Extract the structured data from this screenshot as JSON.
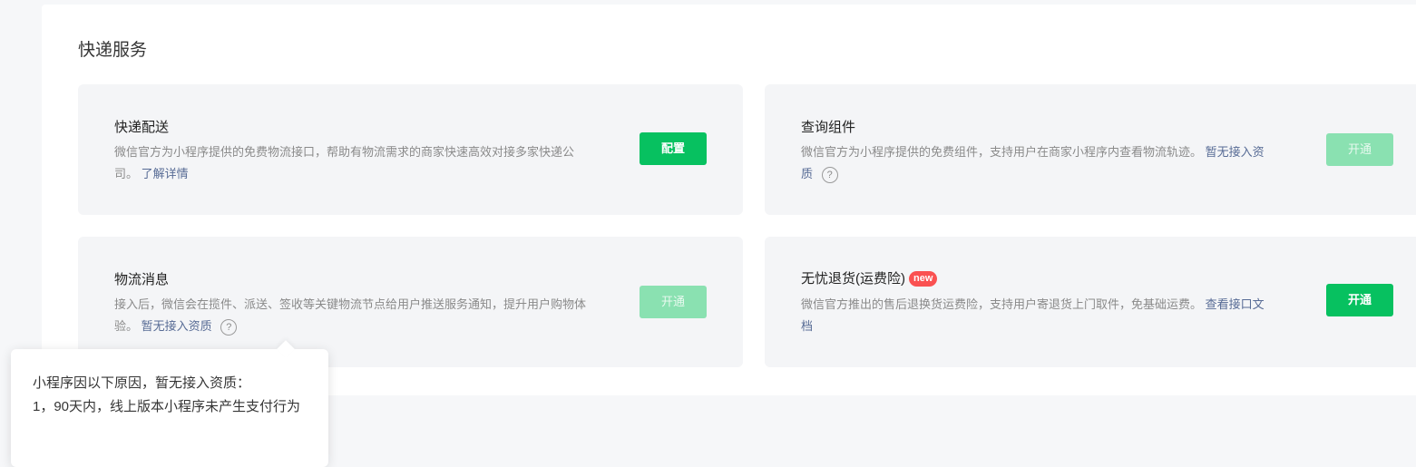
{
  "section": {
    "title": "快递服务"
  },
  "cards": [
    {
      "title": "快递配送",
      "desc": "微信官方为小程序提供的免费物流接口，帮助有物流需求的商家快速高效对接多家快递公司。",
      "link": "了解详情",
      "button": "配置"
    },
    {
      "title": "查询组件",
      "desc": "微信官方为小程序提供的免费组件，支持用户在商家小程序内查看物流轨迹。",
      "link": "暂无接入资质",
      "button": "开通"
    },
    {
      "title": "物流消息",
      "desc": "接入后，微信会在揽件、派送、签收等关键物流节点给用户推送服务通知，提升用户购物体验。",
      "link": "暂无接入资质",
      "button": "开通"
    },
    {
      "title": "无忧退货(运费险)",
      "badge": "new",
      "desc": "微信官方推出的售后退换货运费险，支持用户寄退货上门取件，免基础运费。",
      "link": "查看接口文档",
      "button": "开通"
    }
  ],
  "help_glyph": "?",
  "tooltip": {
    "line1": "小程序因以下原因，暂无接入资质：",
    "line2": "1，90天内，线上版本小程序未产生支付行为"
  },
  "colors": {
    "primary": "#07c160",
    "disabled": "#8ae1b1",
    "link": "#576b95",
    "badge": "#fa5151"
  }
}
